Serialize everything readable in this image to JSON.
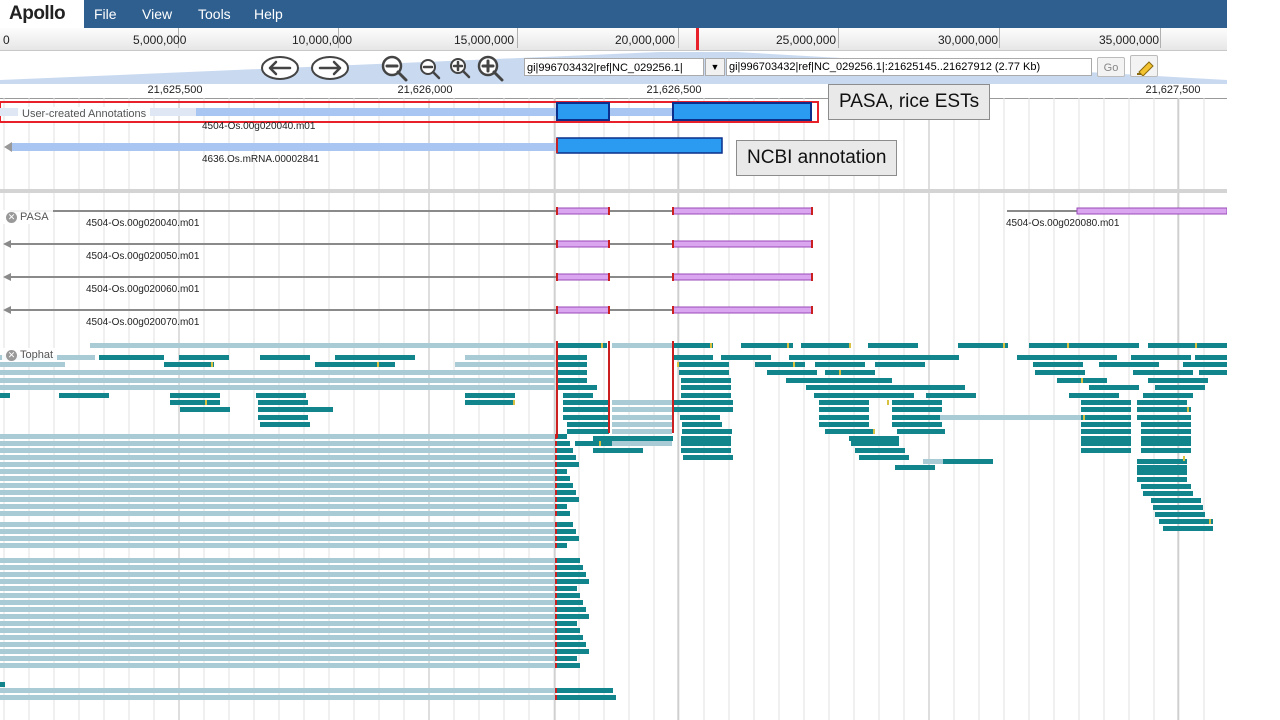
{
  "app": {
    "logo_text": "Apollo"
  },
  "menu": {
    "file": "File",
    "view": "View",
    "tools": "Tools",
    "help": "Help"
  },
  "overview_ticks": [
    "0",
    "5,000,000",
    "10,000,000",
    "15,000,000",
    "20,000,000",
    "25,000,000",
    "30,000,000",
    "35,000,000"
  ],
  "navigation": {
    "sequence_select": "gi|996703432|ref|NC_029256.1|",
    "location_value": "gi|996703432|ref|NC_029256.1|:21625145..21627912 (2.77 Kb)",
    "go_label": "Go"
  },
  "detail_ticks": [
    "21,625,500",
    "21,626,000",
    "21,626,500",
    "21,627,500"
  ],
  "tracks": {
    "user_annotations": {
      "label": "User-created Annotations",
      "features": [
        "4504-Os.00g020040.m01",
        "4636.Os.mRNA.00002841"
      ]
    },
    "pasa": {
      "label": "PASA",
      "features": [
        "4504-Os.00g020040.m01",
        "4504-Os.00g020080.m01",
        "4504-Os.00g020050.m01",
        "4504-Os.00g020060.m01",
        "4504-Os.00g020070.m01"
      ]
    },
    "tophat": {
      "label": "Tophat"
    }
  },
  "callouts": {
    "pasa": "PASA, rice ESTs",
    "ncbi": "NCBI annotation"
  },
  "colors": {
    "menubar": "#2f5f8f",
    "annotation_exon": "#2a9bf0",
    "annotation_intron": "#a9c6f2",
    "pasa_exon": "#d9a6ef",
    "tophat_read": "#12848c",
    "tophat_light": "#a9cbd6",
    "splice_mark": "#cc1f1f"
  }
}
